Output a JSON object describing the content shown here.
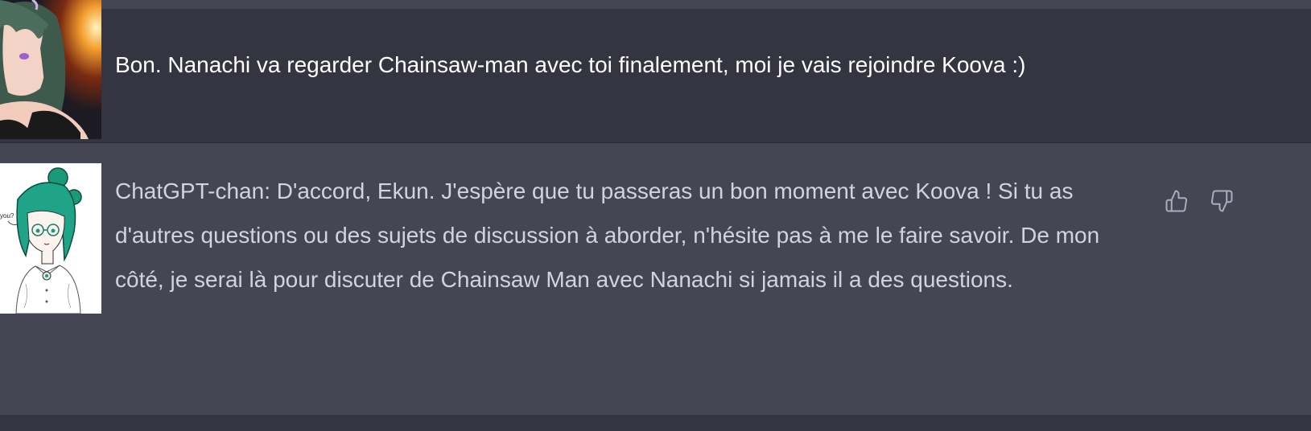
{
  "conversation": {
    "user_message": {
      "avatar_icon": "user-avatar-anime-girl",
      "text": "Bon. Nanachi va regarder Chainsaw-man avec toi finalement, moi je vais rejoindre Koova :)"
    },
    "assistant_message": {
      "avatar_icon": "chatgpt-chan-avatar",
      "avatar_caption": "you?",
      "text": "ChatGPT-chan: D'accord, Ekun. J'espère que tu passeras un bon moment avec Koova ! Si tu as d'autres questions ou des sujets de discussion à aborder, n'hésite pas à me le faire savoir. De mon côté, je serai là pour discuter de Chainsaw Man avec Nanachi si jamais il a des questions."
    },
    "feedback": {
      "thumbs_up_icon": "thumbs-up-icon",
      "thumbs_down_icon": "thumbs-down-icon"
    }
  },
  "colors": {
    "user_row_bg": "#343541",
    "assistant_row_bg": "#444654",
    "text_primary": "#ececf1",
    "text_secondary": "#d1d5db",
    "icon_color": "#acacbe"
  }
}
